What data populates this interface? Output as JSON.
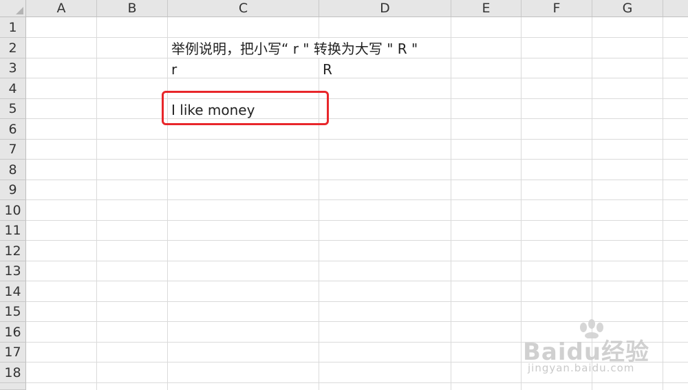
{
  "columns": [
    "A",
    "B",
    "C",
    "D",
    "E",
    "F",
    "G"
  ],
  "rows": [
    "1",
    "2",
    "3",
    "4",
    "5",
    "6",
    "7",
    "8",
    "9",
    "10",
    "11",
    "12",
    "13",
    "14",
    "15",
    "16",
    "17",
    "18"
  ],
  "cells": {
    "C2": "举例说明，把小写“ r \" 转换为大写 \" R \"",
    "C3": "r",
    "D3": "R",
    "C5": "I like money"
  },
  "highlight_color": "#e8262a",
  "watermark": {
    "logo": "Baidu经验",
    "url": "jingyan.baidu.com"
  }
}
